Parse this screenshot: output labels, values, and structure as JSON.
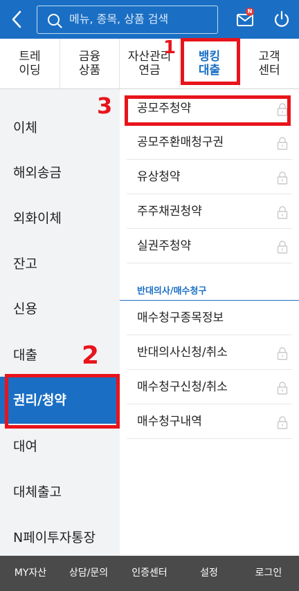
{
  "header": {
    "search_placeholder": "메뉴, 종목, 상품 검색",
    "mail_badge": "N"
  },
  "tabs": [
    {
      "label": "트레\n이딩"
    },
    {
      "label": "금융\n상품"
    },
    {
      "label": "자산관리\n연금"
    },
    {
      "label": "뱅킹\n대출",
      "active": true
    },
    {
      "label": "고객\n센터"
    }
  ],
  "left_menu": [
    {
      "label": "이체"
    },
    {
      "label": "해외송금"
    },
    {
      "label": "외화이체"
    },
    {
      "label": "잔고"
    },
    {
      "label": "신용"
    },
    {
      "label": "대출"
    },
    {
      "label": "권리/청약",
      "active": true
    },
    {
      "label": "대여"
    },
    {
      "label": "대체출고"
    },
    {
      "label": "N페이투자통장"
    }
  ],
  "submenu": {
    "items_top": [
      {
        "label": "공모주청약",
        "locked": true
      },
      {
        "label": "공모주환매청구권",
        "locked": true
      },
      {
        "label": "유상청약",
        "locked": true
      },
      {
        "label": "주주채권청약",
        "locked": true
      },
      {
        "label": "실권주청약",
        "locked": true
      }
    ],
    "section_title": "반대의사/매수청구",
    "items_bottom": [
      {
        "label": "매수청구종목정보",
        "locked": false
      },
      {
        "label": "반대의사신청/취소",
        "locked": true
      },
      {
        "label": "매수청구신청/취소",
        "locked": true
      },
      {
        "label": "매수청구내역",
        "locked": true
      }
    ]
  },
  "bottom_bar": [
    {
      "label": "MY자산"
    },
    {
      "label": "상담/문의"
    },
    {
      "label": "인증센터"
    },
    {
      "label": "설정"
    },
    {
      "label": "로그인"
    }
  ],
  "annotations": [
    "1",
    "2",
    "3"
  ],
  "colors": {
    "brand_blue": "#1a6fc4",
    "highlight_red": "#e8141b",
    "left_menu_bg": "#f2f3f5",
    "bottom_bar_bg": "#4a4a4a"
  }
}
